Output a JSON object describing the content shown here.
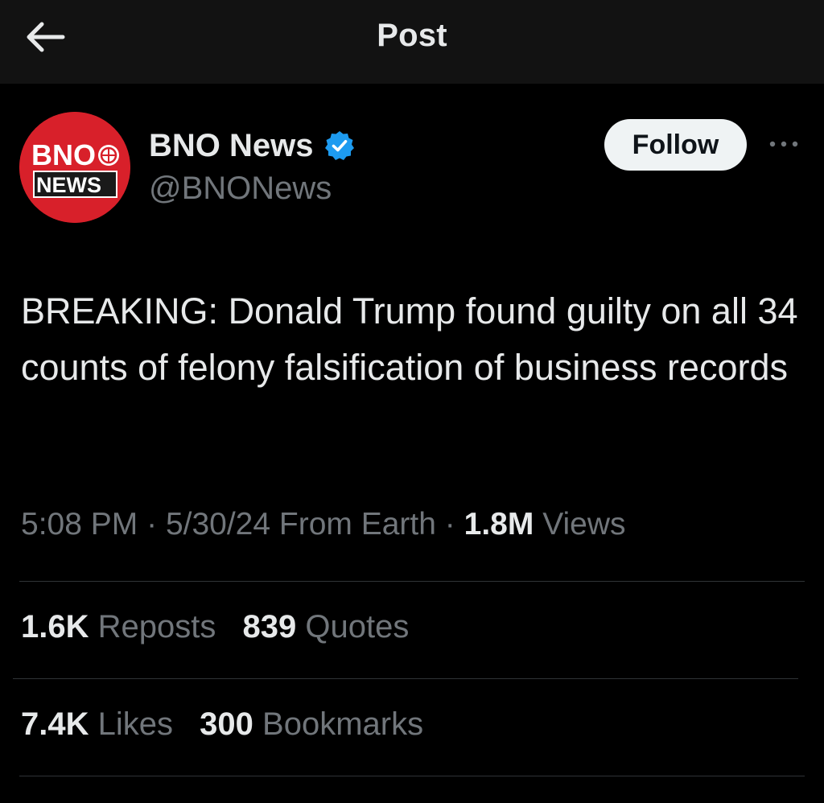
{
  "header": {
    "title": "Post",
    "back_icon": "arrow-left-icon"
  },
  "author": {
    "name": "BNO News",
    "handle": "@BNONews",
    "verified": true,
    "avatar_text_top": "BNO",
    "avatar_text_bottom": "NEWS",
    "avatar_color": "#d8202a",
    "verified_color": "#1d9bf0"
  },
  "actions": {
    "follow_label": "Follow",
    "more_icon": "more-horizontal-icon"
  },
  "post": {
    "text": "BREAKING: Donald Trump found guilty on all 34 counts of felony falsification of business records",
    "time": "5:08 PM",
    "separator": "·",
    "date": "5/30/24",
    "location": "From Earth",
    "views_count": "1.8M",
    "views_label": "Views"
  },
  "stats": {
    "reposts_count": "1.6K",
    "reposts_label": "Reposts",
    "quotes_count": "839",
    "quotes_label": "Quotes",
    "likes_count": "7.4K",
    "likes_label": "Likes",
    "bookmarks_count": "300",
    "bookmarks_label": "Bookmarks"
  },
  "colors": {
    "background": "#000000",
    "header_background": "#121212",
    "primary_text": "#e7e9ea",
    "secondary_text": "#71767b",
    "divider": "#2f3336"
  }
}
